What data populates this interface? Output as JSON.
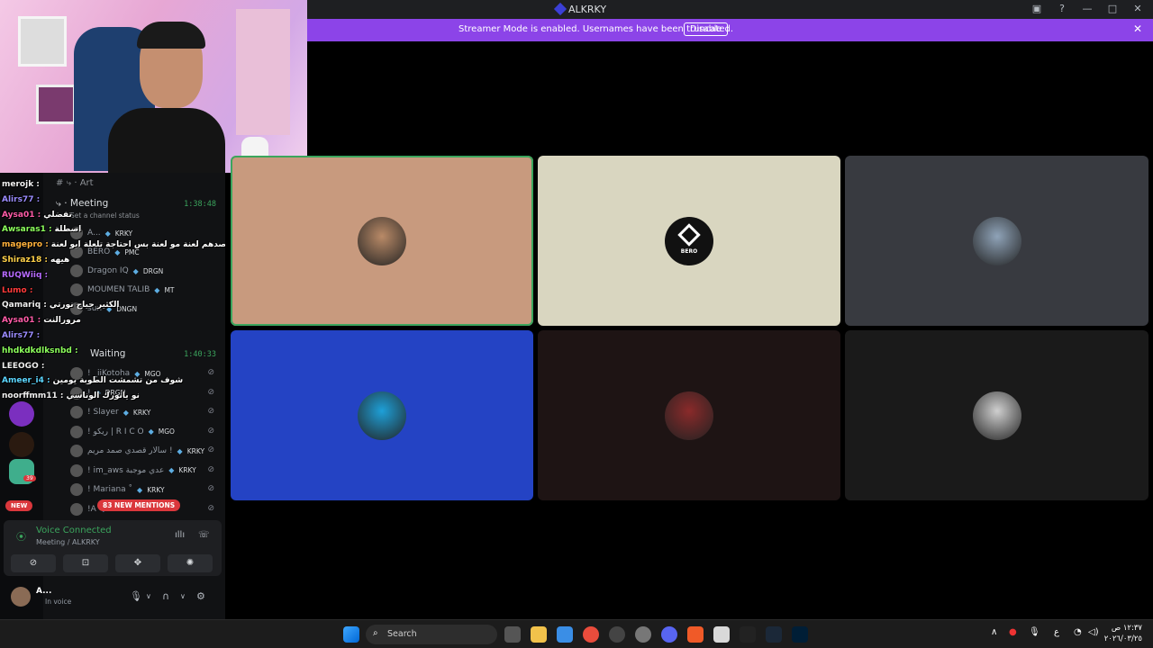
{
  "window": {
    "title": "ALKRKY"
  },
  "banner": {
    "message": "Streamer Mode is enabled. Usernames have been truncated.",
    "disable_label": "Disable"
  },
  "channels": {
    "art": "Art",
    "meeting": "Meeting",
    "meeting_time": "1:38:48",
    "meeting_status": "Set a channel status",
    "waiting": "Waiting",
    "waiting_time": "1:40:33"
  },
  "meeting_members": [
    {
      "name": "A...",
      "tag": "KRKY"
    },
    {
      "name": "BERO",
      "tag": "PMC"
    },
    {
      "name": "Dragon IQ",
      "tag": "DRGN"
    },
    {
      "name": "MOUMEN TALIB",
      "tag": "MT"
    },
    {
      "name": "sun",
      "tag": "DNGN"
    }
  ],
  "waiting_members": [
    {
      "name": "! _iiKotoha",
      "tag": "MGO"
    },
    {
      "name": "!",
      "tag": "DRGN"
    },
    {
      "name": "! Slayer",
      "tag": "KRKY"
    },
    {
      "name": "! ريكو | R I C O",
      "tag": "MGO"
    },
    {
      "name": "سالار قصدي صمد مريم !",
      "tag": "KRKY"
    },
    {
      "name": "! im_aws عدي موجبة",
      "tag": "KRKY"
    },
    {
      "name": "! Mariana ˚",
      "tag": "KRKY"
    },
    {
      "name": "!A",
      "tag": "DRG"
    }
  ],
  "mentions_label": "83 NEW MENTIONS",
  "new_label": "NEW",
  "server_badge": "39",
  "chat": [
    {
      "user": "merojk :",
      "msg": "",
      "color": "#f0f0f0"
    },
    {
      "user": "Alirs77 :",
      "msg": "",
      "color": "#9b8cff"
    },
    {
      "user": "Aysa01 :",
      "msg": "تفضلي",
      "color": "#ff5ca8"
    },
    {
      "user": "Awsaras1 :",
      "msg": "اصطلة",
      "color": "#8cff5c"
    },
    {
      "user": "magepro :",
      "msg": "لا قصدهم لعنة مو لعنة بس احتاجة تلعلة ابو لعنة",
      "color": "#ffb13b"
    },
    {
      "user": "Shiraz18 :",
      "msg": "هيهه",
      "color": "#ffd24a"
    },
    {
      "user": "RUQWiiq :",
      "msg": "",
      "color": "#b76bff"
    },
    {
      "user": "Lumo :",
      "msg": "",
      "color": "#ff3b3b"
    },
    {
      "user": "Qamariq :",
      "msg": "الكثير حياج نورتي",
      "color": "#f0f0f0"
    },
    {
      "user": "Aysa01 :",
      "msg": "مرورالنت",
      "color": "#ff5ca8"
    },
    {
      "user": "Alirs77 :",
      "msg": "",
      "color": "#9b8cff"
    },
    {
      "user": "hhdkdkdlksnbd :",
      "msg": "",
      "color": "#8cff5c"
    },
    {
      "user": "LEEOGO :",
      "msg": "",
      "color": "#f0f0f0"
    },
    {
      "user": "Ameer_i4 :",
      "msg": "شوف من تشمشت الطوبة يومين",
      "color": "#5cd6ff"
    },
    {
      "user": "noorffmm11 :",
      "msg": "نو يانورك الوناسي",
      "color": "#f0f0f0"
    }
  ],
  "voice": {
    "title": "Voice Connected",
    "sub": "Meeting / ALKRKY"
  },
  "user": {
    "name": "A...",
    "status": "In voice"
  },
  "taskbar": {
    "search_placeholder": "Search",
    "lang": "ع",
    "time": "١٢:٣٧ ص",
    "date": "٢٠٢٦/٠٣/٢٥"
  },
  "tiles": [
    {
      "color": "#c89a7e",
      "speaking": true
    },
    {
      "color": "#d9d6c0",
      "speaking": false
    },
    {
      "color": "#383a40",
      "speaking": false
    },
    {
      "color": "#2443c4",
      "speaking": false
    },
    {
      "color": "#1e1414",
      "speaking": false
    },
    {
      "color": "#1a1a1a",
      "speaking": false
    }
  ],
  "bero_label": "BERO",
  "colors": {
    "accent_purple": "#8c44e8",
    "voice_green": "#3ba55d",
    "mention_red": "#da373c"
  }
}
